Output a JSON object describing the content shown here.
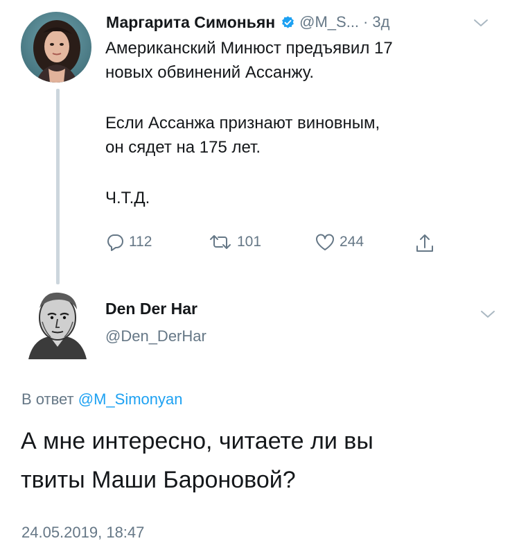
{
  "tweet1": {
    "author_name": "Маргарита Симоньян",
    "handle": "@M_S...",
    "separator": "·",
    "time": "3д",
    "body": [
      "Американский Минюст предъявил 17\nновых обвинений Ассанжу.",
      "Если Ассанжа признают виновным,\nон сядет на 175 лет.",
      "Ч.Т.Д."
    ],
    "actions": {
      "reply_count": "112",
      "retweet_count": "101",
      "like_count": "244"
    },
    "icons": [
      "verified-badge-icon",
      "chevron-down-icon",
      "reply-icon",
      "retweet-icon",
      "like-icon",
      "share-icon"
    ]
  },
  "tweet2": {
    "author_name": "Den Der Har",
    "handle": "@Den_DerHar",
    "reply_prefix": "В ответ",
    "reply_mention": "@M_Simonyan",
    "body_line1": "А мне интересно, читаете ли вы",
    "body_line2": "твиты Маши Бароновой?",
    "timestamp": "24.05.2019, 18:47"
  },
  "colors": {
    "text": "#14171a",
    "secondary": "#657786",
    "link": "#1da1f2",
    "verified": "#1da1f2",
    "thread_line": "#ccd6dd"
  }
}
